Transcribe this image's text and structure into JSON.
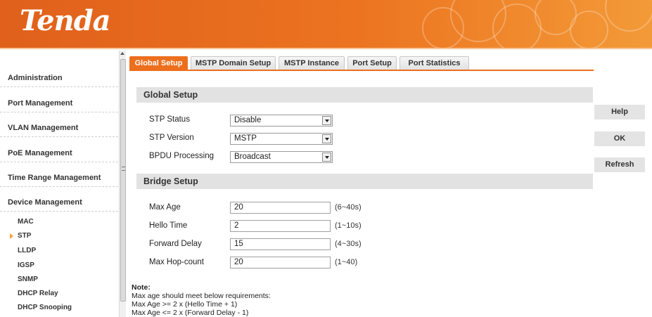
{
  "brand": {
    "logo_text": "Tenda",
    "accent_color": "#ec6f1e"
  },
  "sidebar": {
    "sections": [
      {
        "label": "Administration"
      },
      {
        "label": "Port Management"
      },
      {
        "label": "VLAN Management"
      },
      {
        "label": "PoE Management"
      },
      {
        "label": "Time Range Management"
      },
      {
        "label": "Device Management"
      }
    ],
    "sub_items": [
      {
        "label": "MAC"
      },
      {
        "label": "STP",
        "active": true
      },
      {
        "label": "LLDP"
      },
      {
        "label": "IGSP"
      },
      {
        "label": "SNMP"
      },
      {
        "label": "DHCP Relay"
      },
      {
        "label": "DHCP Snooping"
      }
    ]
  },
  "tabs": [
    {
      "label": "Global Setup",
      "active": true
    },
    {
      "label": "MSTP Domain Setup"
    },
    {
      "label": "MSTP Instance"
    },
    {
      "label": "Port Setup"
    },
    {
      "label": "Port Statistics"
    }
  ],
  "global_setup": {
    "title": "Global Setup",
    "stp_status": {
      "label": "STP Status",
      "value": "Disable"
    },
    "stp_version": {
      "label": "STP Version",
      "value": "MSTP"
    },
    "bpdu_processing": {
      "label": "BPDU Processing",
      "value": "Broadcast"
    }
  },
  "bridge_setup": {
    "title": "Bridge Setup",
    "max_age": {
      "label": "Max Age",
      "value": "20",
      "hint": "(6~40s)"
    },
    "hello_time": {
      "label": "Hello Time",
      "value": "2",
      "hint": "(1~10s)"
    },
    "forward_delay": {
      "label": "Forward Delay",
      "value": "15",
      "hint": "(4~30s)"
    },
    "max_hop_count": {
      "label": "Max Hop-count",
      "value": "20",
      "hint": "(1~40)"
    }
  },
  "buttons": {
    "help": "Help",
    "ok": "OK",
    "refresh": "Refresh"
  },
  "note": {
    "title": "Note:",
    "lines": [
      "Max age should meet below requirements:",
      "Max Age >= 2 x (Hello Time + 1)",
      "Max Age <= 2 x (Forward Delay - 1)"
    ]
  }
}
